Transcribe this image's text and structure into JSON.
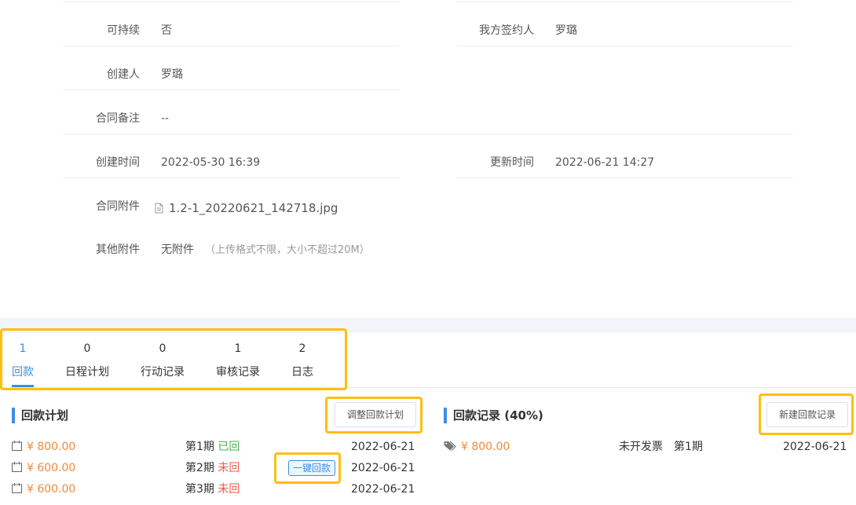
{
  "details": {
    "sustainable_label": "可持续",
    "sustainable_value": "否",
    "our_signer_label": "我方签约人",
    "our_signer_value": "罗璐",
    "creator_label": "创建人",
    "creator_value": "罗璐",
    "remark_label": "合同备注",
    "remark_value": "--",
    "created_time_label": "创建时间",
    "created_time_value": "2022-05-30 16:39",
    "updated_time_label": "更新时间",
    "updated_time_value": "2022-06-21 14:27",
    "attachment_label": "合同附件",
    "attachment_file": "1.2-1_20220621_142718.jpg",
    "other_attachment_label": "其他附件",
    "other_attachment_value": "无附件",
    "other_attachment_hint": "（上传格式不限，大小不超过20M）"
  },
  "tabs": [
    {
      "count": "1",
      "label": "回款",
      "active": true
    },
    {
      "count": "0",
      "label": "日程计划",
      "active": false
    },
    {
      "count": "0",
      "label": "行动记录",
      "active": false
    },
    {
      "count": "1",
      "label": "审核记录",
      "active": false
    },
    {
      "count": "2",
      "label": "日志",
      "active": false
    }
  ],
  "plan": {
    "title": "回款计划",
    "adjust_button": "调整回款计划",
    "one_click_button": "一键回款",
    "rows": [
      {
        "amount": "¥ 800.00",
        "period": "第1期",
        "status": "已回",
        "status_type": "ok",
        "date": "2022-06-21"
      },
      {
        "amount": "¥ 600.00",
        "period": "第2期",
        "status": "未回",
        "status_type": "no",
        "date": "2022-06-21"
      },
      {
        "amount": "¥ 600.00",
        "period": "第3期",
        "status": "未回",
        "status_type": "no",
        "date": "2022-06-21"
      }
    ]
  },
  "records": {
    "title": "回款记录 (40%)",
    "new_button": "新建回款记录",
    "rows": [
      {
        "amount": "¥ 800.00",
        "invoice": "未开发票",
        "period": "第1期",
        "date": "2022-06-21"
      }
    ]
  },
  "colors": {
    "accent": "#3a8ee6",
    "highlight": "#ffbf10",
    "amount": "#f08a3c",
    "status_ok": "#49b355",
    "status_no": "#f05a4a"
  }
}
